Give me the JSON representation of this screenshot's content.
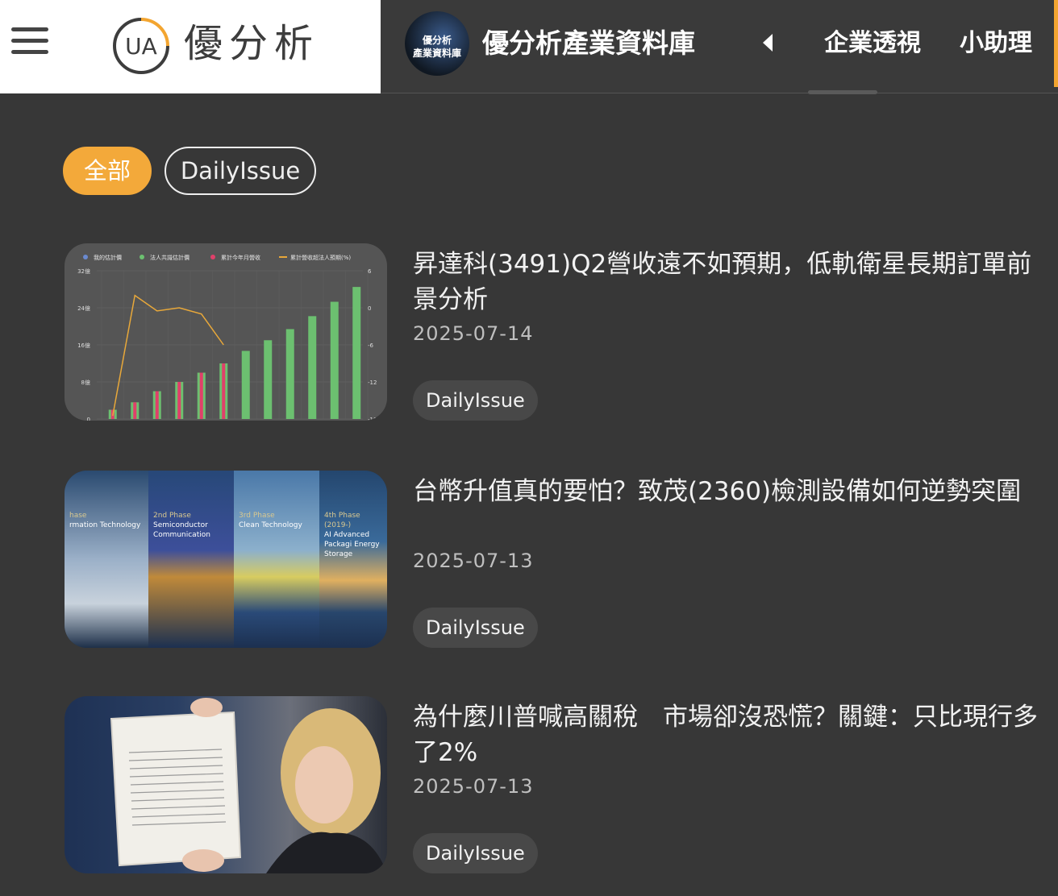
{
  "header": {
    "brand": "優分析",
    "logo_letters": "UA",
    "db_title": "優分析產業資料庫",
    "avatar_line1": "優分析",
    "avatar_line2": "產業資料庫",
    "nav": [
      "企業透視",
      "小助理"
    ],
    "accent_color": "#f3a530"
  },
  "filters": [
    {
      "label": "全部",
      "active": true
    },
    {
      "label": "DailyIssue",
      "active": false
    }
  ],
  "articles": [
    {
      "title": "昇達科(3491)Q2營收遠不如預期，低軌衛星長期訂單前景分析",
      "date": "2025-07-14",
      "tag": "DailyIssue",
      "thumb": "chart"
    },
    {
      "title": "台幣升值真的要怕？致茂(2360)檢測設備如何逆勢突圍",
      "date": "2025-07-13",
      "tag": "DailyIssue",
      "thumb": "phases"
    },
    {
      "title": "為什麼川普喊高關稅　市場卻沒恐慌？關鍵：只比現行多了2%",
      "date": "2025-07-13",
      "tag": "DailyIssue",
      "thumb": "photo"
    }
  ],
  "chart_data": {
    "type": "bar",
    "legend": [
      "我的估計價",
      "法人共識估計價",
      "累計今年月營收",
      "累計營收超法人預期(%)"
    ],
    "y_ticks": [
      "32億",
      "24億",
      "16億",
      "8億",
      "0"
    ],
    "y2_ticks": [
      "6",
      "0",
      "-6",
      "-12",
      "-18"
    ],
    "ylim": [
      0,
      32
    ],
    "y2lim": [
      -18,
      6
    ],
    "series": [
      {
        "name": "累計今年月營收",
        "values": [
          2,
          3.6,
          6,
          8,
          10,
          12
        ]
      },
      {
        "name": "法人共識估計價",
        "values": [
          2,
          3.6,
          6,
          8,
          10,
          12,
          14.7,
          17,
          19.4,
          22.2,
          25.3,
          28.5
        ]
      },
      {
        "name": "累計營收超法人預期(%)",
        "values": [
          -17.5,
          2,
          -0.5,
          0,
          -1,
          -6
        ]
      }
    ],
    "colors": {
      "green": "#6cc070",
      "red": "#e0406a",
      "orange": "#e8a83a",
      "blue": "#6a8ad0"
    }
  },
  "phases": [
    {
      "phase": "hase",
      "name": "rmation Technology"
    },
    {
      "phase": "2nd Phase",
      "name": "Semiconductor Communication"
    },
    {
      "phase": "3rd Phase",
      "name": "Clean Technology"
    },
    {
      "phase": "4th Phase (2019-)",
      "name": "AI Advanced Packagi Energy Storage"
    }
  ]
}
